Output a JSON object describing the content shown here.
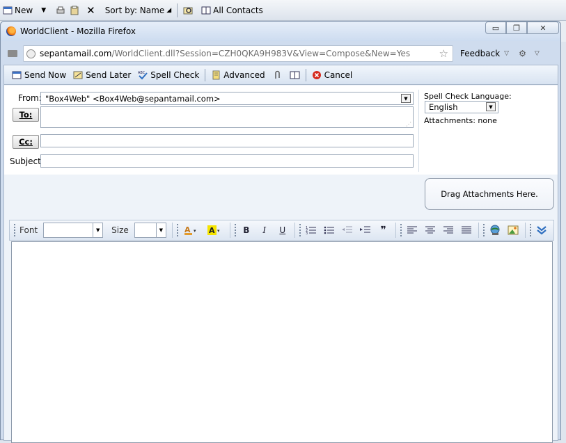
{
  "background_app": {
    "toolbar": {
      "new_label": "New",
      "sort_label": "Sort by: Name",
      "contacts_label": "All Contacts"
    }
  },
  "firefox": {
    "window_title": "WorldClient - Mozilla Firefox",
    "url_host": "sepantamail.com",
    "url_path": "/WorldClient.dll?Session=CZH0QKA9H983V&View=Compose&New=Yes",
    "feedback_label": "Feedback",
    "window_controls": {
      "minimize": "▭",
      "restore": "❐",
      "close": "✕"
    }
  },
  "compose": {
    "toolbar": {
      "send_now": "Send Now",
      "send_later": "Send Later",
      "spell_check": "Spell Check",
      "advanced": "Advanced",
      "cancel": "Cancel"
    },
    "fields": {
      "from_label": "From:",
      "from_value": "\"Box4Web\" <Box4Web@sepantamail.com>",
      "to_button": "To:",
      "to_value": "",
      "cc_button": "Cc:",
      "cc_value": "",
      "subject_label": "Subject:",
      "subject_value": ""
    },
    "side": {
      "spell_lang_label": "Spell Check Language:",
      "spell_lang_value": "English",
      "attachments_label": "Attachments: none",
      "drag_label": "Drag Attachments Here."
    },
    "editor_toolbar": {
      "font_label": "Font",
      "font_value": "",
      "size_label": "Size",
      "size_value": "",
      "bold": "B",
      "italic": "I",
      "underline": "U"
    },
    "body_value": ""
  },
  "colors": {
    "accent_blue": "#2f6fc0",
    "cancel_red": "#d62a1e",
    "highlight_yellow": "#f5e400"
  }
}
